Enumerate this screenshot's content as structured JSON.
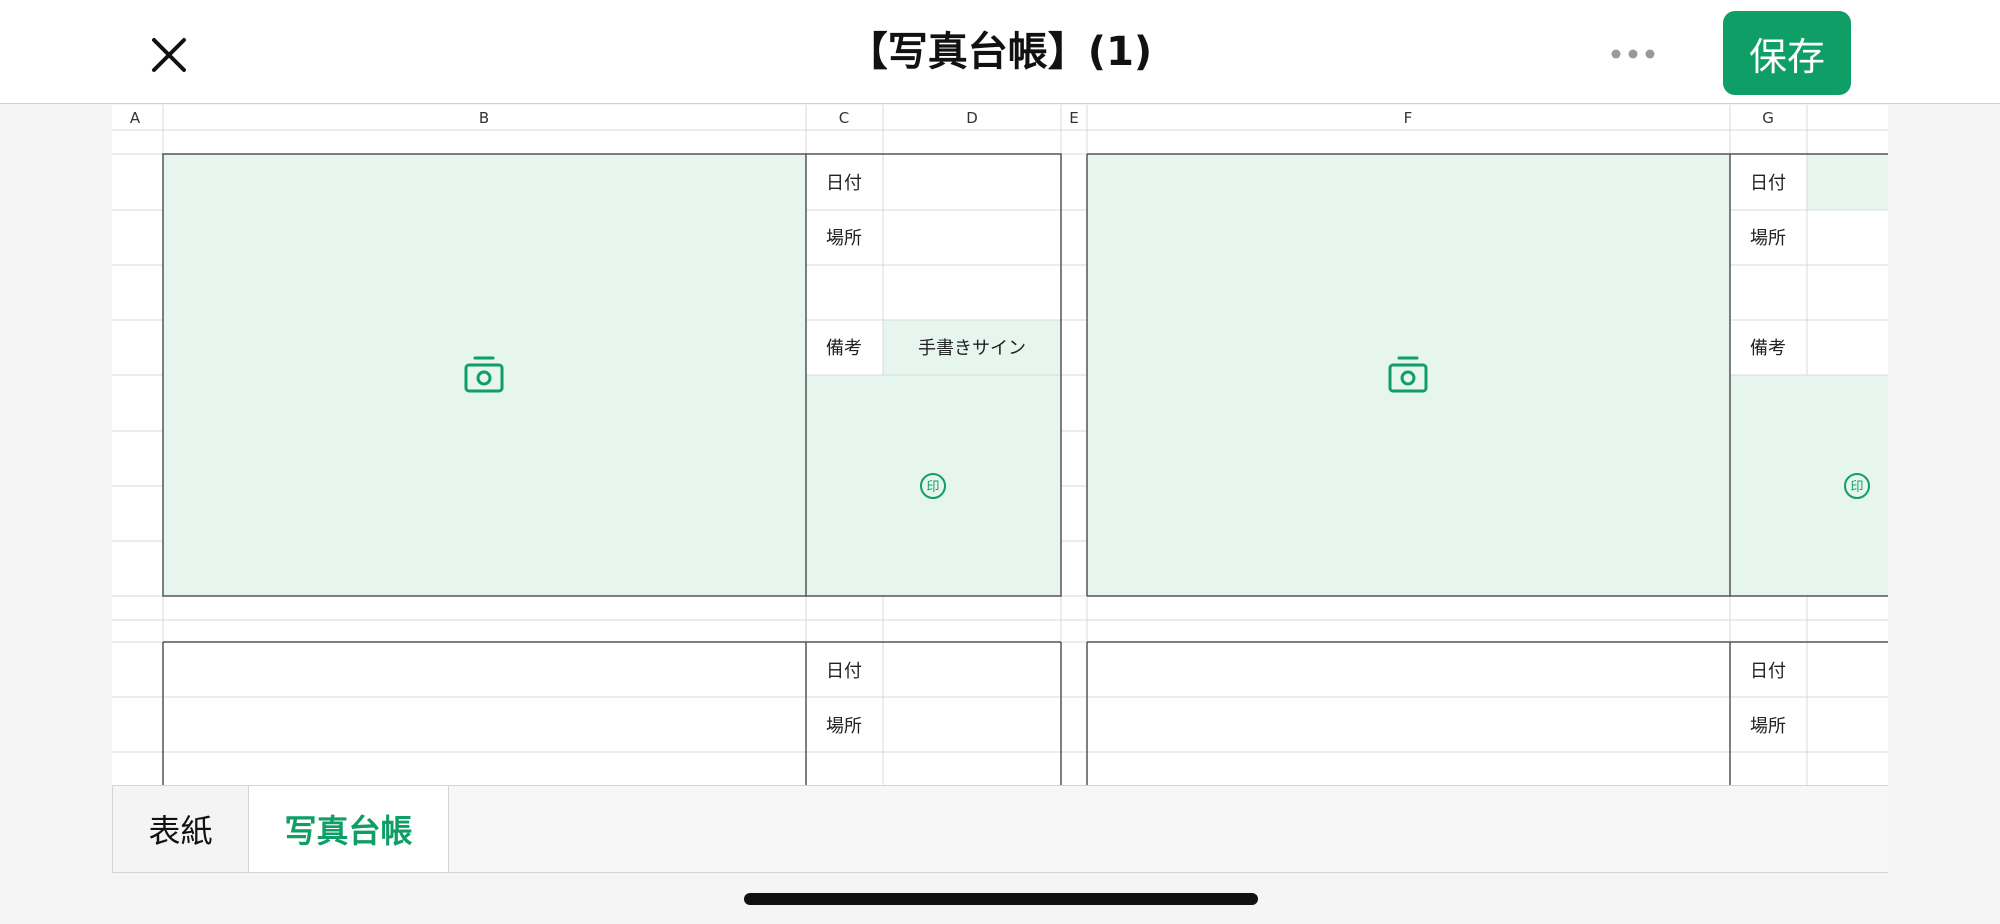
{
  "header": {
    "title": "【写真台帳】(1)",
    "save_label": "保存",
    "close_icon": "close-icon",
    "more_icon": "more-horizontal-icon"
  },
  "sheet": {
    "columns": [
      "A",
      "B",
      "C",
      "D",
      "E",
      "F",
      "G"
    ],
    "blocks": [
      {
        "photo_icon": "camera-icon",
        "date_label": "日付",
        "place_label": "場所",
        "remarks_label": "備考",
        "signature_label": "手書きサイン",
        "stamp_label": "印"
      },
      {
        "photo_icon": "camera-icon",
        "date_label": "日付",
        "place_label": "場所",
        "remarks_label": "備考",
        "stamp_label": "印"
      },
      {
        "date_label": "日付",
        "place_label": "場所"
      },
      {
        "date_label": "日付",
        "place_label": "場所"
      }
    ]
  },
  "tabs": [
    {
      "label": "表紙",
      "active": false
    },
    {
      "label": "写真台帳",
      "active": true
    }
  ],
  "colors": {
    "accent": "#0f9f66",
    "photo_fill": "#e6f5ee",
    "grid_line": "#d9d9d9",
    "border_line": "#555555"
  }
}
